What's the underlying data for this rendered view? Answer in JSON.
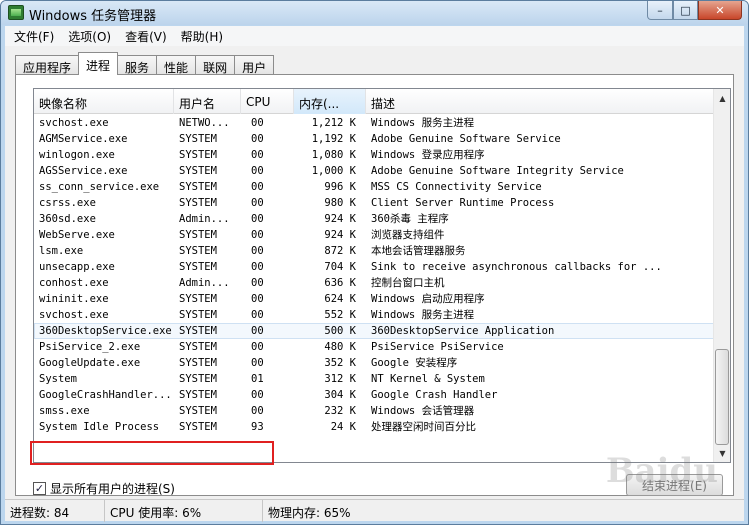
{
  "window": {
    "title": "Windows 任务管理器"
  },
  "menu": [
    "文件(F)",
    "选项(O)",
    "查看(V)",
    "帮助(H)"
  ],
  "tabs": [
    {
      "label": "应用程序",
      "active": false
    },
    {
      "label": "进程",
      "active": true
    },
    {
      "label": "服务",
      "active": false
    },
    {
      "label": "性能",
      "active": false
    },
    {
      "label": "联网",
      "active": false
    },
    {
      "label": "用户",
      "active": false
    }
  ],
  "columns": {
    "name": "映像名称",
    "user": "用户名",
    "cpu": "CPU",
    "mem": "内存(...",
    "desc": "描述"
  },
  "processes": [
    {
      "name": "svchost.exe",
      "user": "NETWO...",
      "cpu": "00",
      "mem": "1,212 K",
      "desc": "Windows 服务主进程"
    },
    {
      "name": "AGMService.exe",
      "user": "SYSTEM",
      "cpu": "00",
      "mem": "1,192 K",
      "desc": "Adobe Genuine Software Service"
    },
    {
      "name": "winlogon.exe",
      "user": "SYSTEM",
      "cpu": "00",
      "mem": "1,080 K",
      "desc": "Windows 登录应用程序"
    },
    {
      "name": "AGSService.exe",
      "user": "SYSTEM",
      "cpu": "00",
      "mem": "1,000 K",
      "desc": "Adobe Genuine Software Integrity Service"
    },
    {
      "name": "ss_conn_service.exe",
      "user": "SYSTEM",
      "cpu": "00",
      "mem": "996 K",
      "desc": "MSS CS Connectivity Service"
    },
    {
      "name": "csrss.exe",
      "user": "SYSTEM",
      "cpu": "00",
      "mem": "980 K",
      "desc": "Client Server Runtime Process"
    },
    {
      "name": "360sd.exe",
      "user": "Admin...",
      "cpu": "00",
      "mem": "924 K",
      "desc": "360杀毒 主程序"
    },
    {
      "name": "WebServe.exe",
      "user": "SYSTEM",
      "cpu": "00",
      "mem": "924 K",
      "desc": "浏览器支持组件"
    },
    {
      "name": "lsm.exe",
      "user": "SYSTEM",
      "cpu": "00",
      "mem": "872 K",
      "desc": "本地会话管理器服务"
    },
    {
      "name": "unsecapp.exe",
      "user": "SYSTEM",
      "cpu": "00",
      "mem": "704 K",
      "desc": "Sink to receive asynchronous callbacks for ..."
    },
    {
      "name": "conhost.exe",
      "user": "Admin...",
      "cpu": "00",
      "mem": "636 K",
      "desc": "控制台窗口主机"
    },
    {
      "name": "wininit.exe",
      "user": "SYSTEM",
      "cpu": "00",
      "mem": "624 K",
      "desc": "Windows 启动应用程序"
    },
    {
      "name": "svchost.exe",
      "user": "SYSTEM",
      "cpu": "00",
      "mem": "552 K",
      "desc": "Windows 服务主进程"
    },
    {
      "name": "360DesktopService.exe",
      "user": "SYSTEM",
      "cpu": "00",
      "mem": "500 K",
      "desc": "360DesktopService Application"
    },
    {
      "name": "PsiService_2.exe",
      "user": "SYSTEM",
      "cpu": "00",
      "mem": "480 K",
      "desc": "PsiService PsiService"
    },
    {
      "name": "GoogleUpdate.exe",
      "user": "SYSTEM",
      "cpu": "00",
      "mem": "352 K",
      "desc": "Google 安装程序"
    },
    {
      "name": "System",
      "user": "SYSTEM",
      "cpu": "01",
      "mem": "312 K",
      "desc": "NT Kernel & System"
    },
    {
      "name": "GoogleCrashHandler...",
      "user": "SYSTEM",
      "cpu": "00",
      "mem": "304 K",
      "desc": "Google Crash Handler"
    },
    {
      "name": "smss.exe",
      "user": "SYSTEM",
      "cpu": "00",
      "mem": "232 K",
      "desc": "Windows 会话管理器"
    },
    {
      "name": "System Idle Process",
      "user": "SYSTEM",
      "cpu": "93",
      "mem": "24 K",
      "desc": "处理器空闲时间百分比"
    }
  ],
  "selected_row_index": 13,
  "show_all_users": {
    "label": "显示所有用户的进程(S)",
    "checked": true
  },
  "end_process_button": "结束进程(E)",
  "status": {
    "processes": "进程数: 84",
    "cpu": "CPU 使用率: 6%",
    "memory": "物理内存: 65%"
  },
  "watermark": "Baidu"
}
